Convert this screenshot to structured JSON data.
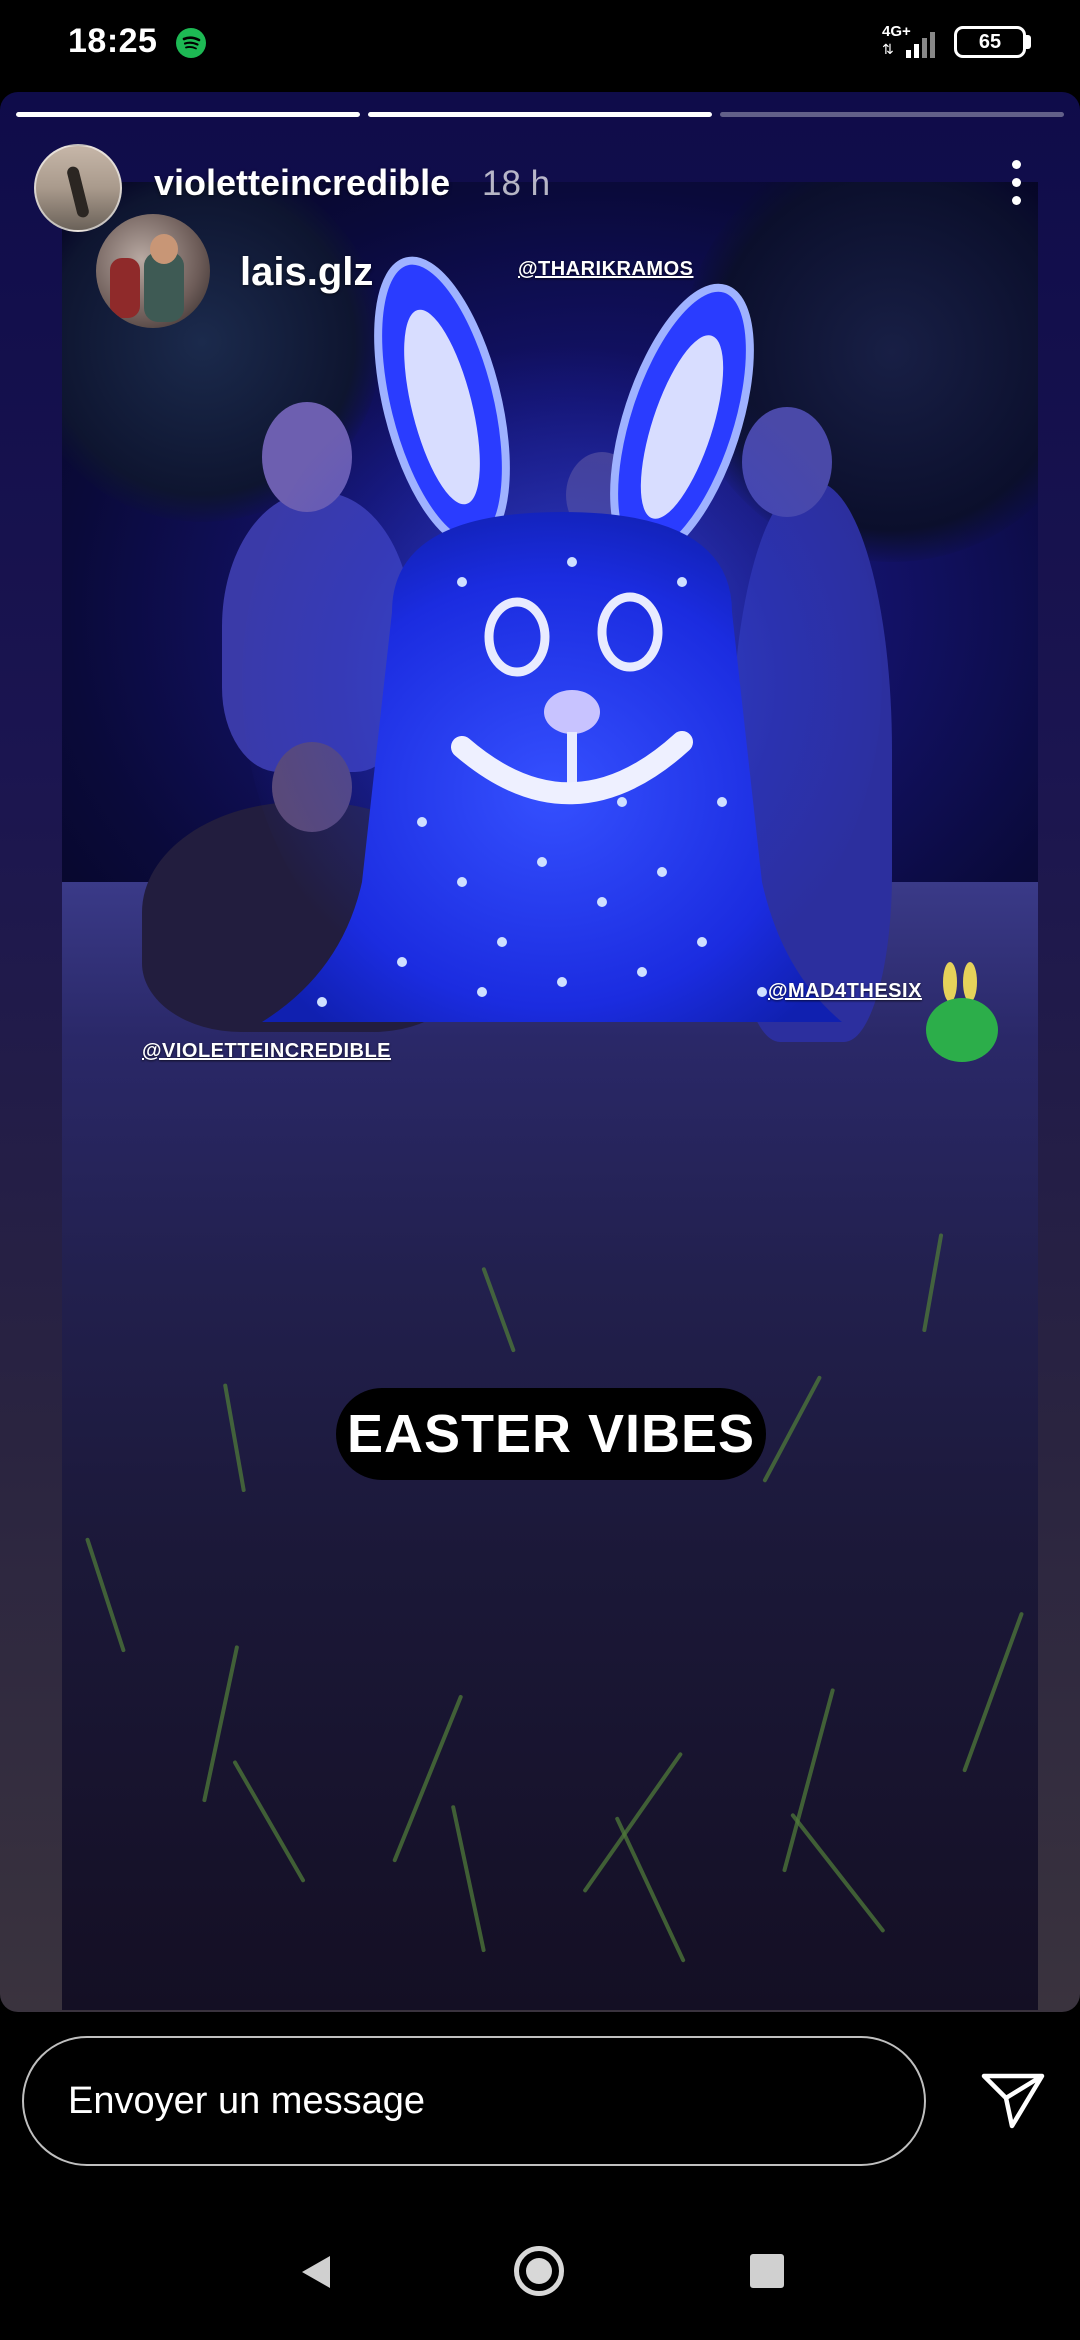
{
  "status_bar": {
    "time": "18:25",
    "app_icon": "spotify-icon",
    "network": "4G+",
    "battery": "65"
  },
  "story": {
    "progress": [
      1.0,
      1.0,
      0.0
    ],
    "user": {
      "username": "violetteincredible",
      "timestamp": "18 h",
      "avatar": "user-avatar"
    },
    "repost": {
      "username": "lais.glz",
      "avatar": "repost-avatar"
    },
    "mentions": {
      "tharik": "@THARIKRAMOS",
      "mad": "@MAD4THESIX",
      "violette": "@VIOLETTEINCREDIBLE"
    },
    "caption": "EASTER VIBES",
    "menu_icon": "more-options-icon"
  },
  "reply": {
    "placeholder": "Envoyer un message",
    "send_icon": "send-icon"
  },
  "nav": {
    "back_icon": "back-icon",
    "home_icon": "home-icon",
    "recents_icon": "recents-icon"
  },
  "colors": {
    "background": "#000000",
    "bunny_blue": "#2a3cff",
    "bunny_white": "#e8eaff",
    "spotify_green": "#1db954"
  }
}
